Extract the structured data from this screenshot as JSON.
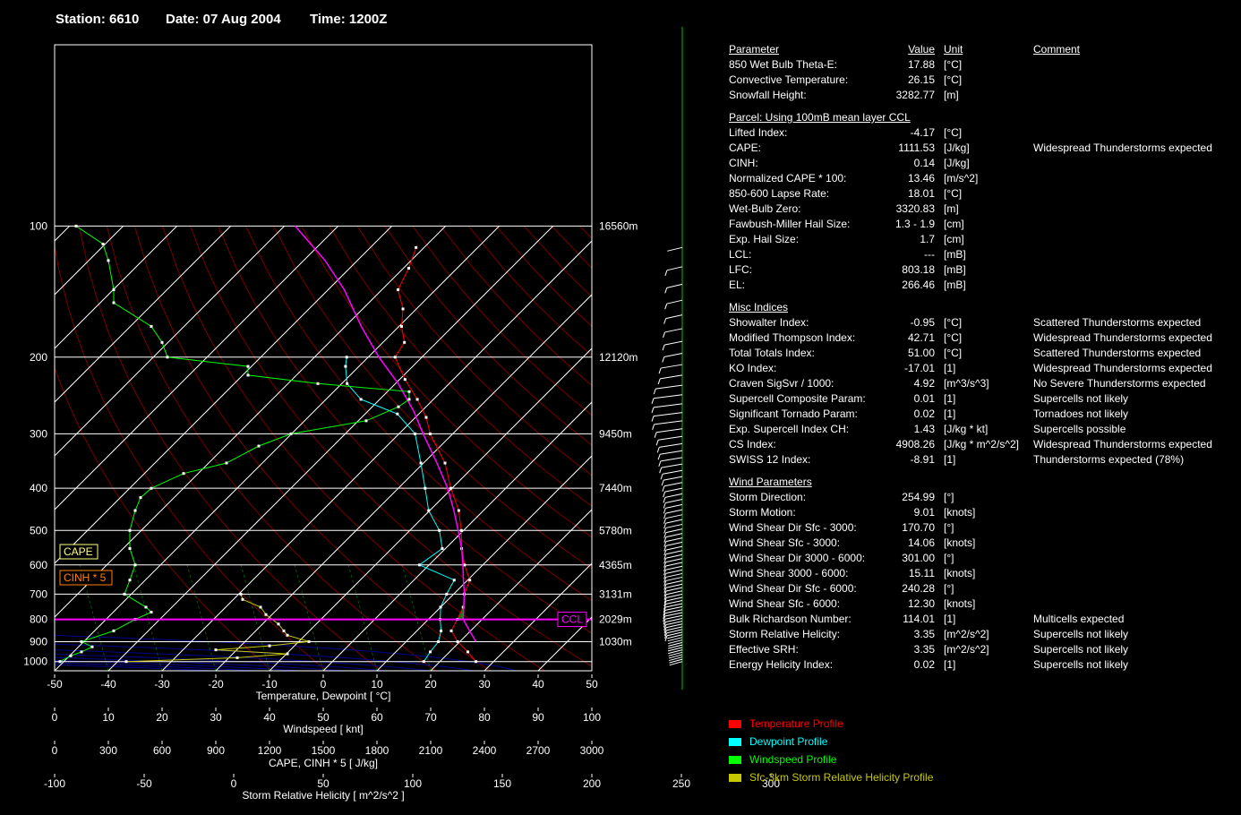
{
  "header": {
    "station": "Station: 6610",
    "date": "Date: 07 Aug 2004",
    "time": "Time: 1200Z"
  },
  "colors": {
    "temperature": "#ff0000",
    "dewpoint": "#00ffff",
    "windspeed": "#00ff00",
    "helicity": "#c8c800",
    "parcel": "#ff00ff",
    "cape_fill": "#008800"
  },
  "chart_data": {
    "type": "line",
    "title": "",
    "pressure_axis": {
      "ticks": [
        100,
        200,
        300,
        400,
        500,
        600,
        700,
        800,
        900,
        1000
      ],
      "ylim": [
        1050,
        100
      ],
      "scale": "log"
    },
    "height_ticks": [
      {
        "p": 100,
        "label": "16560m"
      },
      {
        "p": 200,
        "label": "12120m"
      },
      {
        "p": 300,
        "label": "9450m"
      },
      {
        "p": 400,
        "label": "7440m"
      },
      {
        "p": 500,
        "label": "5780m"
      },
      {
        "p": 600,
        "label": "4365m"
      },
      {
        "p": 700,
        "label": "3131m"
      },
      {
        "p": 800,
        "label": "2029m"
      },
      {
        "p": 900,
        "label": "1030m"
      }
    ],
    "temp_axis": {
      "label": "Temperature, Dewpoint  [ °C]",
      "ticks": [
        -50,
        -40,
        -30,
        -20,
        -10,
        0,
        10,
        20,
        30,
        40,
        50
      ]
    },
    "wind_axis": {
      "label": "Windspeed  [ knt]",
      "ticks": [
        0,
        10,
        20,
        30,
        40,
        50,
        60,
        70,
        80,
        90,
        100
      ]
    },
    "cape_axis": {
      "label": "CAPE, CINH * 5  [ J/kg]",
      "ticks": [
        0,
        300,
        600,
        900,
        1200,
        1500,
        1800,
        2100,
        2400,
        2700,
        3000
      ]
    },
    "srh_axis": {
      "label": "Storm Relative Helicity  [ m^2/s^2 ]",
      "ticks": [
        -100,
        -50,
        0,
        50,
        100,
        150,
        200,
        250,
        300
      ]
    },
    "series": [
      {
        "name": "Temperature Profile",
        "points": [
          [
            1000,
            26.7
          ],
          [
            950,
            23.4
          ],
          [
            900,
            19.6
          ],
          [
            850,
            16.4
          ],
          [
            800,
            15.4
          ],
          [
            750,
            14.2
          ],
          [
            700,
            12.0
          ],
          [
            650,
            10.4
          ],
          [
            600,
            6.6
          ],
          [
            550,
            3.0
          ],
          [
            500,
            -0.4
          ],
          [
            450,
            -4.6
          ],
          [
            400,
            -10.2
          ],
          [
            350,
            -16.0
          ],
          [
            300,
            -24.2
          ],
          [
            275,
            -28.0
          ],
          [
            250,
            -33.0
          ],
          [
            225,
            -39.0
          ],
          [
            200,
            -45.0
          ],
          [
            185,
            -46.0
          ],
          [
            170,
            -49.5
          ],
          [
            155,
            -52.5
          ],
          [
            140,
            -57.0
          ],
          [
            125,
            -59.0
          ],
          [
            112,
            -61.5
          ]
        ]
      },
      {
        "name": "Dewpoint Profile",
        "points": [
          [
            1000,
            17.0
          ],
          [
            950,
            16.4
          ],
          [
            900,
            16.0
          ],
          [
            850,
            14.5
          ],
          [
            800,
            12.2
          ],
          [
            750,
            10.0
          ],
          [
            700,
            8.7
          ],
          [
            650,
            7.5
          ],
          [
            600,
            -1.8
          ],
          [
            550,
            -0.6
          ],
          [
            500,
            -4.5
          ],
          [
            450,
            -10.2
          ],
          [
            400,
            -15.0
          ],
          [
            350,
            -20.5
          ],
          [
            300,
            -27.0
          ],
          [
            270,
            -34.0
          ],
          [
            250,
            -43.5
          ],
          [
            230,
            -49.0
          ],
          [
            210,
            -52.5
          ],
          [
            200,
            -54.0
          ]
        ]
      },
      {
        "name": "Parcel",
        "points": [
          [
            900,
            23.0
          ],
          [
            850,
            19.8
          ],
          [
            800,
            16.5
          ],
          [
            750,
            14.3
          ],
          [
            700,
            12.0
          ],
          [
            650,
            9.2
          ],
          [
            600,
            6.3
          ],
          [
            550,
            3.0
          ],
          [
            500,
            -1.0
          ],
          [
            450,
            -5.5
          ],
          [
            400,
            -10.8
          ],
          [
            350,
            -17.5
          ],
          [
            300,
            -25.5
          ],
          [
            266,
            -31.5
          ],
          [
            230,
            -39.5
          ],
          [
            200,
            -48.0
          ],
          [
            170,
            -57.0
          ],
          [
            140,
            -67.0
          ],
          [
            120,
            -76.0
          ],
          [
            100,
            -88.0
          ]
        ]
      },
      {
        "name": "Windspeed Profile",
        "points": [
          [
            1000,
            1
          ],
          [
            970,
            3
          ],
          [
            950,
            5
          ],
          [
            925,
            7
          ],
          [
            900,
            5
          ],
          [
            850,
            11
          ],
          [
            800,
            15
          ],
          [
            770,
            18
          ],
          [
            750,
            17
          ],
          [
            700,
            13
          ],
          [
            650,
            14
          ],
          [
            600,
            15
          ],
          [
            550,
            14
          ],
          [
            500,
            14
          ],
          [
            450,
            15
          ],
          [
            420,
            16
          ],
          [
            400,
            18
          ],
          [
            370,
            24
          ],
          [
            350,
            32
          ],
          [
            320,
            38
          ],
          [
            300,
            44
          ],
          [
            280,
            58
          ],
          [
            260,
            64
          ],
          [
            250,
            66
          ],
          [
            240,
            66
          ],
          [
            230,
            49
          ],
          [
            220,
            36
          ],
          [
            210,
            36
          ],
          [
            200,
            21
          ],
          [
            185,
            20
          ],
          [
            170,
            18
          ],
          [
            150,
            11
          ],
          [
            140,
            11
          ],
          [
            120,
            10
          ],
          [
            110,
            9
          ],
          [
            100,
            4
          ]
        ]
      },
      {
        "name": "Sfc-3km Storm Relative Helicity Profile",
        "points": [
          [
            1000,
            -60
          ],
          [
            980,
            2
          ],
          [
            960,
            30
          ],
          [
            940,
            -10
          ],
          [
            920,
            20
          ],
          [
            900,
            42
          ],
          [
            870,
            30
          ],
          [
            850,
            28
          ],
          [
            820,
            25
          ],
          [
            780,
            18
          ],
          [
            750,
            15
          ],
          [
            720,
            5
          ],
          [
            700,
            4
          ]
        ]
      }
    ],
    "legend": [
      "Temperature Profile",
      "Dewpoint Profile",
      "Windspeed Profile",
      "Sfc-3km Storm Relative Helicity Profile"
    ],
    "markers": {
      "cape": "CAPE",
      "cinh": "CINH * 5",
      "ccl": "CCL",
      "ccl_pressure": 800
    },
    "grid": true
  },
  "params": {
    "header": {
      "name": "Parameter",
      "value": "Value",
      "unit": "Unit",
      "comment": "Comment"
    },
    "groups": [
      {
        "title": "",
        "rows": [
          {
            "name": "850 Wet Bulb Theta-E:",
            "value": "17.88",
            "unit": "[°C]",
            "comment": ""
          },
          {
            "name": "Convective Temperature:",
            "value": "26.15",
            "unit": "[°C]",
            "comment": ""
          },
          {
            "name": "Snowfall Height:",
            "value": "3282.77",
            "unit": "[m]",
            "comment": ""
          }
        ]
      },
      {
        "title": "Parcel: Using 100mB mean layer CCL",
        "rows": [
          {
            "name": "Lifted Index:",
            "value": "-4.17",
            "unit": "[°C]",
            "comment": ""
          },
          {
            "name": "CAPE:",
            "value": "1111.53",
            "unit": "[J/kg]",
            "comment": "Widespread Thunderstorms expected"
          },
          {
            "name": "CINH:",
            "value": "0.14",
            "unit": "[J/kg]",
            "comment": ""
          },
          {
            "name": "Normalized CAPE * 100:",
            "value": "13.46",
            "unit": "[m/s^2]",
            "comment": ""
          },
          {
            "name": "850-600 Lapse Rate:",
            "value": "18.01",
            "unit": "[°C]",
            "comment": ""
          },
          {
            "name": "Wet-Bulb Zero:",
            "value": "3320.83",
            "unit": "[m]",
            "comment": ""
          },
          {
            "name": "Fawbush-Miller Hail Size:",
            "value": "1.3 - 1.9",
            "unit": "[cm]",
            "comment": ""
          },
          {
            "name": "Exp. Hail Size:",
            "value": "1.7",
            "unit": "[cm]",
            "comment": ""
          },
          {
            "name": "LCL:",
            "value": "---",
            "unit": "[mB]",
            "comment": ""
          },
          {
            "name": "LFC:",
            "value": "803.18",
            "unit": "[mB]",
            "comment": ""
          },
          {
            "name": "EL:",
            "value": "266.46",
            "unit": "[mB]",
            "comment": ""
          }
        ]
      },
      {
        "title": "Misc Indices",
        "rows": [
          {
            "name": "Showalter Index:",
            "value": "-0.95",
            "unit": "[°C]",
            "comment": "Scattered Thunderstorms expected"
          },
          {
            "name": "Modified Thompson Index:",
            "value": "42.71",
            "unit": "[°C]",
            "comment": "Widespread Thunderstorms expected"
          },
          {
            "name": "Total Totals Index:",
            "value": "51.00",
            "unit": "[°C]",
            "comment": "Scattered Thunderstorms expected"
          },
          {
            "name": "KO Index:",
            "value": "-17.01",
            "unit": "[1]",
            "comment": "Widespread Thunderstorms expected"
          },
          {
            "name": "Craven SigSvr / 1000:",
            "value": "4.92",
            "unit": "[m^3/s^3]",
            "comment": "No Severe Thunderstorms expected"
          },
          {
            "name": "Supercell Composite Param:",
            "value": "0.01",
            "unit": "[1]",
            "comment": "Supercells not likely"
          },
          {
            "name": "Significant Tornado Param:",
            "value": "0.02",
            "unit": "[1]",
            "comment": "Tornadoes not likely"
          },
          {
            "name": "Exp. Supercell Index CH:",
            "value": "1.43",
            "unit": "[J/kg * kt]",
            "comment": "Supercells possible"
          },
          {
            "name": "CS Index:",
            "value": "4908.26",
            "unit": "[J/kg * m^2/s^2]",
            "comment": "Widespread Thunderstorms expected"
          },
          {
            "name": "SWISS 12 Index:",
            "value": "-8.91",
            "unit": "[1]",
            "comment": "Thunderstorms expected (78%)"
          }
        ]
      },
      {
        "title": "Wind Parameters",
        "rows": [
          {
            "name": "Storm Direction:",
            "value": "254.99",
            "unit": "[°]",
            "comment": ""
          },
          {
            "name": "Storm Motion:",
            "value": "9.01",
            "unit": "[knots]",
            "comment": ""
          },
          {
            "name": "Wind Shear Dir Sfc - 3000:",
            "value": "170.70",
            "unit": "[°]",
            "comment": ""
          },
          {
            "name": "Wind Shear Sfc - 3000:",
            "value": "14.06",
            "unit": "[knots]",
            "comment": ""
          },
          {
            "name": "Wind Shear Dir 3000 - 6000:",
            "value": "301.00",
            "unit": "[°]",
            "comment": ""
          },
          {
            "name": "Wind Shear 3000 - 6000:",
            "value": "15.11",
            "unit": "[knots]",
            "comment": ""
          },
          {
            "name": "Wind Shear Dir Sfc - 6000:",
            "value": "240.28",
            "unit": "[°]",
            "comment": ""
          },
          {
            "name": "Wind Shear Sfc - 6000:",
            "value": "12.30",
            "unit": "[knots]",
            "comment": ""
          },
          {
            "name": "Bulk Richardson Number:",
            "value": "114.01",
            "unit": "[1]",
            "comment": "Multicells expected"
          },
          {
            "name": "Storm Relative Helicity:",
            "value": "3.35",
            "unit": "[m^2/s^2]",
            "comment": "Supercells not likely"
          },
          {
            "name": "Effective SRH:",
            "value": "3.35",
            "unit": "[m^2/s^2]",
            "comment": "Supercells not likely"
          },
          {
            "name": "Energy Helicity Index:",
            "value": "0.02",
            "unit": "[1]",
            "comment": "Supercells not likely"
          }
        ]
      }
    ]
  }
}
